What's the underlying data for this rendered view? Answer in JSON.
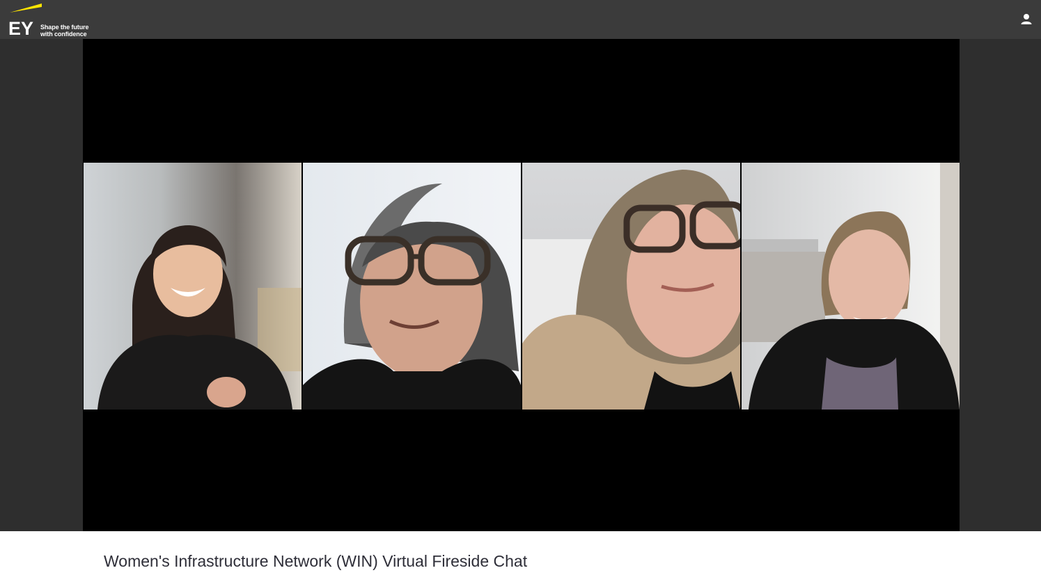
{
  "header": {
    "brand": "EY",
    "tagline_line1": "Shape the future",
    "tagline_line2": "with confidence",
    "brand_accent": "#ffe600",
    "user_icon": "user-icon"
  },
  "video": {
    "participants": [
      {
        "tile": "participant-1"
      },
      {
        "tile": "participant-2"
      },
      {
        "tile": "participant-3"
      },
      {
        "tile": "participant-4"
      }
    ]
  },
  "page": {
    "title": "Women's Infrastructure Network (WIN) Virtual Fireside Chat"
  }
}
